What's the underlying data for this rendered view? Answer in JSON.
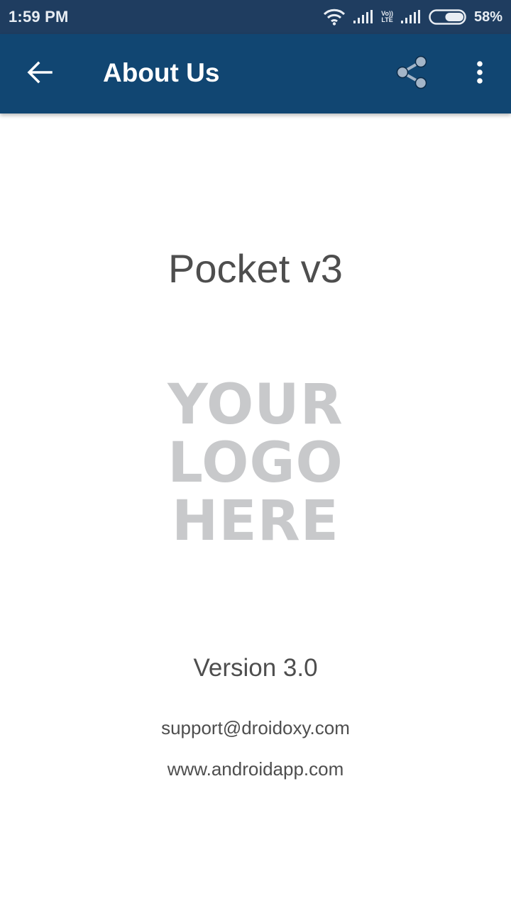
{
  "status_bar": {
    "time": "1:59 PM",
    "icons": [
      "wifi-icon",
      "signal-icon",
      "volte-icon",
      "signal-icon",
      "battery-icon"
    ],
    "volte_top": "Vo))",
    "volte_bottom": "LTE",
    "battery_percent": "58%",
    "battery_level": 0.58
  },
  "app_bar": {
    "title": "About Us",
    "back_icon": "arrow-left-icon",
    "share_icon": "share-icon",
    "more_icon": "more-vertical-icon",
    "background_color": "#114672"
  },
  "main": {
    "app_name": "Pocket v3",
    "logo_lines": [
      "YOUR",
      "LOGO",
      "HERE"
    ],
    "version": "Version 3.0",
    "email": "support@droidoxy.com",
    "website": "www.androidapp.com"
  }
}
